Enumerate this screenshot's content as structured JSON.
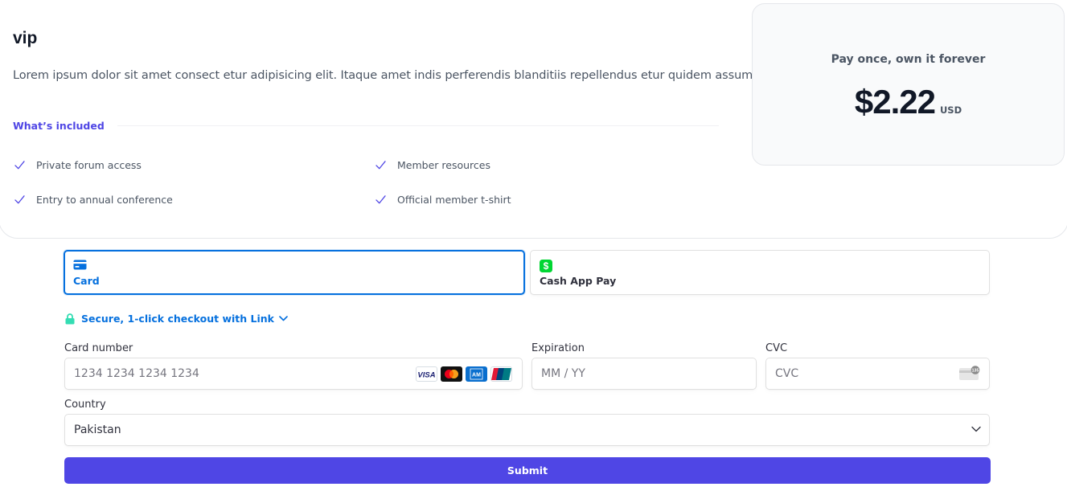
{
  "plan": {
    "title": "vip",
    "description": "Lorem ipsum dolor sit amet consect etur adipisicing elit. Itaque amet indis perferendis blanditiis repellendus etur quidem assumenda.",
    "included_label": "What’s included",
    "features": [
      "Private forum access",
      "Member resources",
      "Entry to annual conference",
      "Official member t-shirt"
    ]
  },
  "pricing": {
    "caption": "Pay once, own it forever",
    "amount": "$2.22",
    "currency": "USD"
  },
  "payment": {
    "tabs": [
      {
        "label": "Card",
        "icon": "card-icon",
        "selected": true
      },
      {
        "label": "Cash App Pay",
        "icon": "cash-app-icon",
        "selected": false
      }
    ],
    "link_text": "Secure, 1-click checkout with Link",
    "card_number": {
      "label": "Card number",
      "placeholder": "1234 1234 1234 1234"
    },
    "card_brands": [
      "visa-logo",
      "mastercard-logo",
      "amex-logo",
      "unionpay-logo"
    ],
    "expiration": {
      "label": "Expiration",
      "placeholder": "MM / YY"
    },
    "cvc": {
      "label": "CVC",
      "placeholder": "CVC"
    },
    "country": {
      "label": "Country",
      "value": "Pakistan"
    },
    "submit_label": "Submit"
  },
  "colors": {
    "accent": "#4f46e5",
    "stripe_blue": "#0570de",
    "link_green": "#33ddb3",
    "cash_app_green": "#00d632"
  }
}
